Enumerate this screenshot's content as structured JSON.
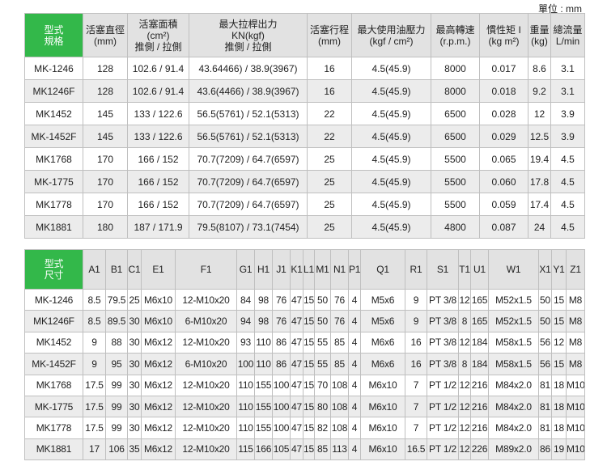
{
  "unit_label": "單位 : mm",
  "colors": {
    "header_green": "#33b84a",
    "header_gray": "#e2e2e2",
    "row_alt": "#ececec"
  },
  "table1": {
    "headers": [
      [
        "型式",
        "規格"
      ],
      [
        "活塞直徑",
        "(mm)"
      ],
      [
        "活塞面積",
        "(cm²)",
        "推側 / 拉側"
      ],
      [
        "最大拉桿出力",
        "KN(kgf)",
        "推側 / 拉側"
      ],
      [
        "活塞行程",
        "(mm)"
      ],
      [
        "最大使用油壓力",
        "(kgf / cm²)"
      ],
      [
        "最高轉速",
        "(r.p.m.)"
      ],
      [
        "慣性矩 I",
        "(kg  m²)"
      ],
      [
        "重量",
        "(kg)"
      ],
      [
        "總流量",
        "L/min"
      ]
    ],
    "rows": [
      [
        "MK-1246",
        "128",
        "102.6 / 91.4",
        "43.64466) / 38.9(3967)",
        "16",
        "4.5(45.9)",
        "8000",
        "0.017",
        "8.6",
        "3.1"
      ],
      [
        "MK1246F",
        "128",
        "102.6 / 91.4",
        "43.6(4466) / 38.9(3967)",
        "16",
        "4.5(45.9)",
        "8000",
        "0.018",
        "9.2",
        "3.1"
      ],
      [
        "MK1452",
        "145",
        "133 / 122.6",
        "56.5(5761) / 52.1(5313)",
        "22",
        "4.5(45.9)",
        "6500",
        "0.028",
        "12",
        "3.9"
      ],
      [
        "MK-1452F",
        "145",
        "133 / 122.6",
        "56.5(5761) / 52.1(5313)",
        "22",
        "4.5(45.9)",
        "6500",
        "0.029",
        "12.5",
        "3.9"
      ],
      [
        "MK1768",
        "170",
        "166 / 152",
        "70.7(7209) / 64.7(6597)",
        "25",
        "4.5(45.9)",
        "5500",
        "0.065",
        "19.4",
        "4.5"
      ],
      [
        "MK-1775",
        "170",
        "166 / 152",
        "70.7(7209) / 64.7(6597)",
        "25",
        "4.5(45.9)",
        "5500",
        "0.060",
        "17.8",
        "4.5"
      ],
      [
        "MK1778",
        "170",
        "166 / 152",
        "70.7(7209) / 64.7(6597)",
        "25",
        "4.5(45.9)",
        "5500",
        "0.059",
        "17.4",
        "4.5"
      ],
      [
        "MK1881",
        "180",
        "187 / 171.9",
        "79.5(8107) / 73.1(7454)",
        "25",
        "4.5(45.9)",
        "4800",
        "0.087",
        "24",
        "4.5"
      ]
    ]
  },
  "table2": {
    "first_header": [
      "型式",
      "尺寸"
    ],
    "headers": [
      "A1",
      "B1",
      "C1",
      "E1",
      "F1",
      "G1",
      "H1",
      "J1",
      "K1",
      "L1",
      "M1",
      "N1",
      "P1",
      "Q1",
      "R1",
      "S1",
      "T1",
      "U1",
      "W1",
      "X1",
      "Y1",
      "Z1"
    ],
    "rows": [
      [
        "MK-1246",
        "8.5",
        "79.5",
        "25",
        "M6x10",
        "12-M10x20",
        "84",
        "98",
        "76",
        "47",
        "15",
        "50",
        "76",
        "4",
        "M5x6",
        "9",
        "PT 3/8",
        "12",
        "165",
        "M52x1.5",
        "50",
        "15",
        "M8"
      ],
      [
        "MK1246F",
        "8.5",
        "89.5",
        "30",
        "M6x10",
        "6-M10x20",
        "94",
        "98",
        "76",
        "47",
        "15",
        "50",
        "76",
        "4",
        "M5x6",
        "9",
        "PT 3/8",
        "8",
        "165",
        "M52x1.5",
        "50",
        "15",
        "M8"
      ],
      [
        "MK1452",
        "9",
        "88",
        "30",
        "M6x12",
        "12-M10x20",
        "93",
        "110",
        "86",
        "47",
        "15",
        "55",
        "85",
        "4",
        "M6x6",
        "16",
        "PT 3/8",
        "12",
        "184",
        "M58x1.5",
        "56",
        "12",
        "M8"
      ],
      [
        "MK-1452F",
        "9",
        "95",
        "30",
        "M6x12",
        "6-M10x20",
        "100",
        "110",
        "86",
        "47",
        "15",
        "55",
        "85",
        "4",
        "M6x6",
        "16",
        "PT 3/8",
        "8",
        "184",
        "M58x1.5",
        "56",
        "15",
        "M8"
      ],
      [
        "MK1768",
        "17.5",
        "99",
        "30",
        "M6x12",
        "12-M10x20",
        "110",
        "155",
        "100",
        "47",
        "15",
        "70",
        "108",
        "4",
        "M6x10",
        "7",
        "PT 1/2",
        "12",
        "216",
        "M84x2.0",
        "81",
        "18",
        "M10"
      ],
      [
        "MK-1775",
        "17.5",
        "99",
        "30",
        "M6x12",
        "12-M10x20",
        "110",
        "155",
        "100",
        "47",
        "15",
        "80",
        "108",
        "4",
        "M6x10",
        "7",
        "PT 1/2",
        "12",
        "216",
        "M84x2.0",
        "81",
        "18",
        "M10"
      ],
      [
        "MK1778",
        "17.5",
        "99",
        "30",
        "M6x12",
        "12-M10x20",
        "110",
        "155",
        "100",
        "47",
        "15",
        "82",
        "108",
        "4",
        "M6x10",
        "7",
        "PT 1/2",
        "12",
        "216",
        "M84x2.0",
        "81",
        "18",
        "M10"
      ],
      [
        "MK1881",
        "17",
        "106",
        "35",
        "M6x12",
        "12-M10x20",
        "115",
        "166",
        "105",
        "47",
        "15",
        "85",
        "113",
        "4",
        "M6x10",
        "16.5",
        "PT 1/2",
        "12",
        "226",
        "M89x2.0",
        "86",
        "19",
        "M10"
      ]
    ]
  }
}
